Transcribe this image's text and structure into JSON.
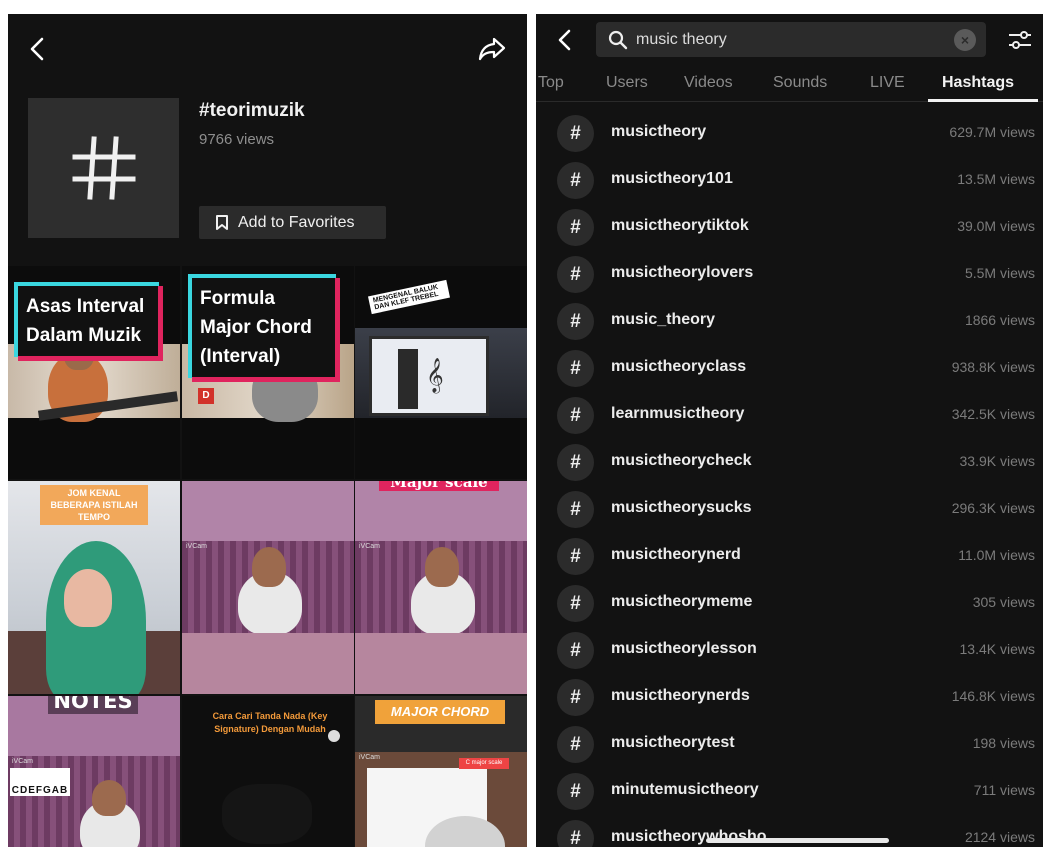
{
  "left_panel": {
    "tag": {
      "name": "#teorimuzik",
      "views": "9766 views",
      "favorite_label": "Add to Favorites"
    },
    "videos": [
      {
        "caption_lines": [
          "Asas Interval",
          "Dalam Muzik"
        ]
      },
      {
        "caption_lines": [
          "Formula",
          "Major Chord",
          "(Interval)"
        ],
        "badge": "D"
      },
      {
        "sticker": "MENGENAL BALUK DAN KLEF TREBEL"
      },
      {
        "caption": "JOM KENAL BEBERAPA ISTILAH TEMPO"
      },
      {
        "watermark": "iVCam"
      },
      {
        "caption": "Major scale",
        "watermark": "iVCam"
      },
      {
        "caption": "NOTES",
        "watermark": "iVCam",
        "keys": "CDEFGAB"
      },
      {
        "caption": "Cara Cari Tanda Nada (Key Signature) Dengan Mudah"
      },
      {
        "caption": "MAJOR CHORD",
        "watermark": "iVCam",
        "tag": "C major scale"
      }
    ]
  },
  "right_panel": {
    "search": {
      "query": "music theory"
    },
    "tabs": [
      {
        "label": "Top"
      },
      {
        "label": "Users"
      },
      {
        "label": "Videos"
      },
      {
        "label": "Sounds"
      },
      {
        "label": "LIVE"
      },
      {
        "label": "Hashtags",
        "active": true
      }
    ],
    "hash_symbol": "#",
    "hashtags": [
      {
        "name": "musictheory",
        "views": "629.7M views"
      },
      {
        "name": "musictheory101",
        "views": "13.5M views"
      },
      {
        "name": "musictheorytiktok",
        "views": "39.0M views"
      },
      {
        "name": "musictheorylovers",
        "views": "5.5M views"
      },
      {
        "name": "music_theory",
        "views": "1866 views"
      },
      {
        "name": "musictheoryclass",
        "views": "938.8K views"
      },
      {
        "name": "learnmusictheory",
        "views": "342.5K views"
      },
      {
        "name": "musictheorycheck",
        "views": "33.9K views"
      },
      {
        "name": "musictheorysucks",
        "views": "296.3K views"
      },
      {
        "name": "musictheorynerd",
        "views": "11.0M views"
      },
      {
        "name": "musictheorymeme",
        "views": "305 views"
      },
      {
        "name": "musictheorylesson",
        "views": "13.4K views"
      },
      {
        "name": "musictheorynerds",
        "views": "146.8K views"
      },
      {
        "name": "musictheorytest",
        "views": "198 views"
      },
      {
        "name": "minutemusictheory",
        "views": "711 views"
      },
      {
        "name": "musictheorywhosho",
        "views": "2124 views"
      }
    ]
  }
}
